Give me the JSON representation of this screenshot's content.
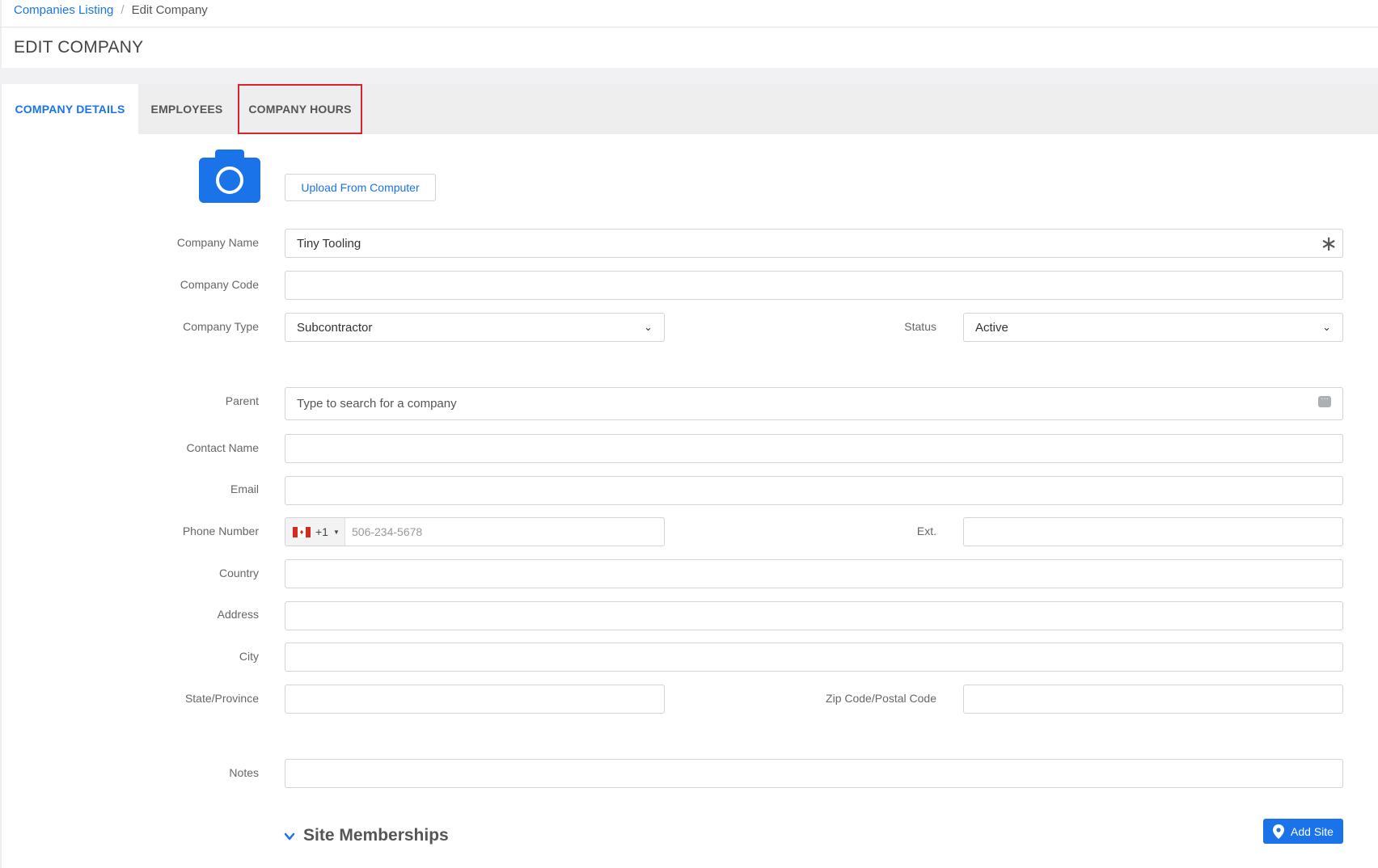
{
  "breadcrumb": {
    "link": "Companies Listing",
    "separator": "/",
    "current": "Edit Company"
  },
  "page_title": "EDIT COMPANY",
  "tabs": [
    {
      "label": "COMPANY DETAILS",
      "active": true
    },
    {
      "label": "EMPLOYEES",
      "active": false
    },
    {
      "label": "COMPANY HOURS",
      "active": false,
      "highlighted": true
    }
  ],
  "photo": {
    "icon": "camera-icon",
    "upload_label": "Upload From Computer"
  },
  "form": {
    "company_name": {
      "label": "Company Name",
      "value": "Tiny Tooling",
      "required_icon": "asterisk-icon"
    },
    "company_code": {
      "label": "Company Code",
      "value": ""
    },
    "company_type": {
      "label": "Company Type",
      "value": "Subcontractor"
    },
    "status": {
      "label": "Status",
      "value": "Active"
    },
    "parent": {
      "label": "Parent",
      "placeholder": "Type to search for a company",
      "icon": "ellipsis-icon"
    },
    "contact_name": {
      "label": "Contact Name",
      "value": ""
    },
    "email": {
      "label": "Email",
      "value": ""
    },
    "phone": {
      "label": "Phone Number",
      "flag": "canada-flag-icon",
      "dial_code": "+1",
      "placeholder": "506-234-5678"
    },
    "ext": {
      "label": "Ext.",
      "value": ""
    },
    "country": {
      "label": "Country",
      "value": ""
    },
    "address": {
      "label": "Address",
      "value": ""
    },
    "city": {
      "label": "City",
      "value": ""
    },
    "state": {
      "label": "State/Province",
      "value": ""
    },
    "zip": {
      "label": "Zip Code/Postal Code",
      "value": ""
    },
    "notes": {
      "label": "Notes",
      "value": ""
    }
  },
  "site_memberships": {
    "title": "Site Memberships",
    "add_button": "Add Site"
  },
  "colors": {
    "accent": "#1a73e8",
    "highlight_box": "#d9232e",
    "tabbar_bg": "#eeeeee"
  }
}
